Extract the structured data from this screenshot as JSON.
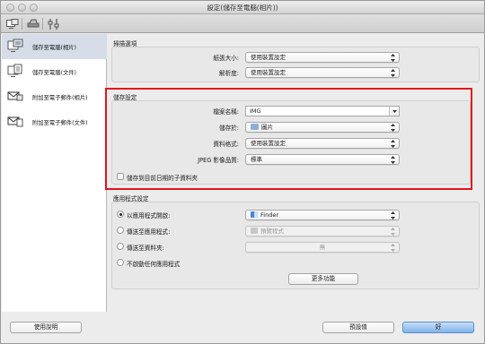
{
  "window": {
    "title": "設定(儲存至電腦(相片))"
  },
  "sidebar": {
    "items": [
      {
        "label": "儲存至電腦(相片)",
        "icon": "save-photo-icon",
        "selected": true
      },
      {
        "label": "儲存至電腦(文件)",
        "icon": "save-document-icon",
        "selected": false
      },
      {
        "label": "附加至電子郵件(相片)",
        "icon": "email-photo-icon",
        "selected": false
      },
      {
        "label": "附加至電子郵件(文件)",
        "icon": "email-document-icon",
        "selected": false
      }
    ]
  },
  "scan_options": {
    "title": "掃描選項",
    "paper_size_label": "紙張大小:",
    "paper_size_value": "使用裝置設定",
    "resolution_label": "解析度:",
    "resolution_value": "使用裝置設定"
  },
  "save_settings": {
    "title": "儲存設定",
    "file_name_label": "檔案名稱:",
    "file_name_value": "IMG",
    "save_in_label": "儲存於:",
    "save_in_value": "圖片",
    "data_format_label": "資料格式:",
    "data_format_value": "使用裝置設定",
    "jpeg_quality_label": "JPEG 影像品質:",
    "jpeg_quality_value": "標準",
    "subfolder_checkbox_label": "儲存到目前日期的子資料夾",
    "subfolder_checked": false
  },
  "app_settings": {
    "title": "應用程式設定",
    "open_with_label": "以應用程式開啟:",
    "open_with_value": "Finder",
    "send_to_app_label": "傳送至應用程式:",
    "send_to_app_value": "預覽程式",
    "send_to_folder_label": "傳送至資料夾:",
    "send_to_folder_value": "無",
    "do_not_start_label": "不啟動任何應用程式",
    "more_functions_label": "更多功能",
    "selected_option": "open_with"
  },
  "footer": {
    "help_label": "使用說明",
    "defaults_label": "預設值",
    "ok_label": "好"
  },
  "colors": {
    "highlight": "#e3141b",
    "selected_sidebar": "#d6dde9",
    "default_button": "#7fb3ea"
  }
}
